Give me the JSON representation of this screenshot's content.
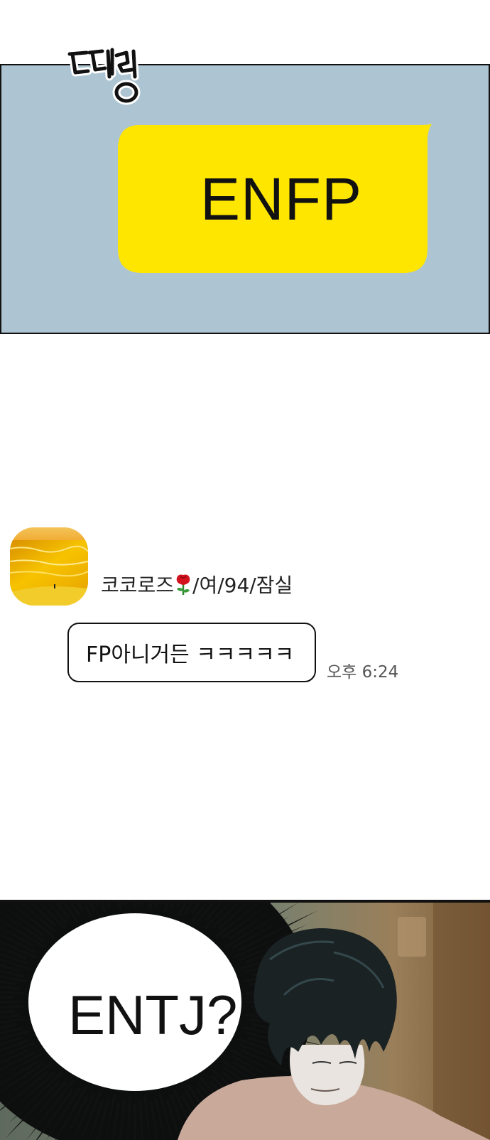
{
  "panel1": {
    "sfx_text": "띠링",
    "message_bubble_text": "ENFP",
    "bubble_color": "#ffe600",
    "background_color": "#adc5d2"
  },
  "chat": {
    "sender_name": "코코로즈",
    "sender_icon": "rose-emoji",
    "sender_suffix": "/여/94/잠실",
    "message_text": "FP아니거든 ㅋㅋㅋㅋㅋ",
    "time": "오후 6:24"
  },
  "panel2": {
    "shout_text": "ENTJ?"
  }
}
